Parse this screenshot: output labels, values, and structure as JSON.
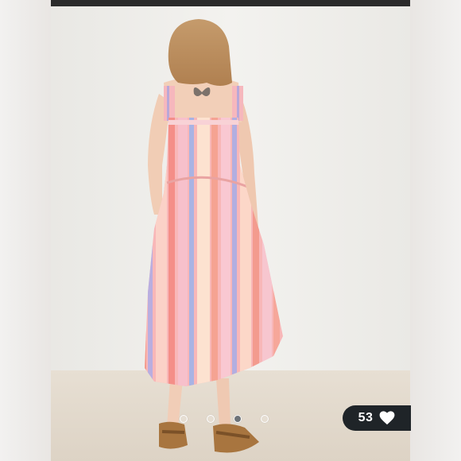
{
  "listing": {
    "likes_count": "53",
    "like_icon": "heart-icon"
  },
  "carousel": {
    "dot_count": 4,
    "active_index": 2
  },
  "colors": {
    "topbar": "#2b2b2b",
    "badge_background": "#1f2428",
    "active_dot": "#6d7378"
  }
}
